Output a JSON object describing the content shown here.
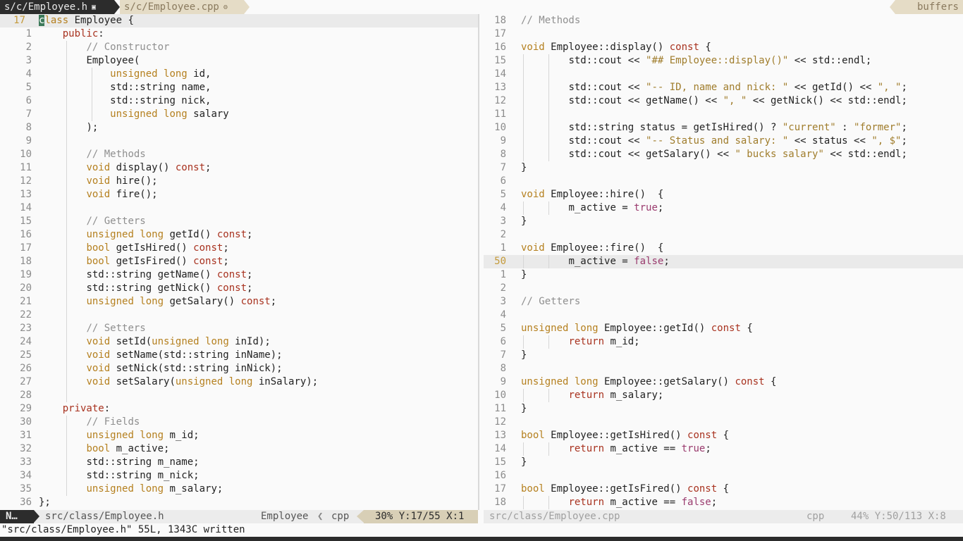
{
  "tabline": {
    "active_tab": "s/c/Employee.h",
    "active_tab_icon": "▣",
    "inactive_tab": "s/c/Employee.cpp",
    "inactive_tab_icon": "⚙",
    "buffers_label": "buffers"
  },
  "left_pane": {
    "lines": [
      {
        "ln": "17",
        "current": true,
        "indent": 0,
        "tokens": [
          [
            "cursor",
            "c"
          ],
          [
            "ty",
            "lass"
          ],
          [
            "",
            " Employee {"
          ]
        ]
      },
      {
        "ln": "1",
        "indent": 4,
        "tokens": [
          [
            "kw",
            "public"
          ],
          [
            "",
            ":"
          ]
        ]
      },
      {
        "ln": "2",
        "indent": 8,
        "tokens": [
          [
            "cm",
            "// Constructor"
          ]
        ]
      },
      {
        "ln": "3",
        "indent": 8,
        "tokens": [
          [
            "",
            "Employee("
          ]
        ]
      },
      {
        "ln": "4",
        "indent": 12,
        "tokens": [
          [
            "ty",
            "unsigned long"
          ],
          [
            "",
            " id,"
          ]
        ]
      },
      {
        "ln": "5",
        "indent": 12,
        "tokens": [
          [
            "",
            "std::string name,"
          ]
        ]
      },
      {
        "ln": "6",
        "indent": 12,
        "tokens": [
          [
            "",
            "std::string nick,"
          ]
        ]
      },
      {
        "ln": "7",
        "indent": 12,
        "tokens": [
          [
            "ty",
            "unsigned long"
          ],
          [
            "",
            " salary"
          ]
        ]
      },
      {
        "ln": "8",
        "indent": 8,
        "tokens": [
          [
            "",
            ");"
          ]
        ]
      },
      {
        "ln": "9",
        "indent": 8,
        "tokens": []
      },
      {
        "ln": "10",
        "indent": 8,
        "tokens": [
          [
            "cm",
            "// Methods"
          ]
        ]
      },
      {
        "ln": "11",
        "indent": 8,
        "tokens": [
          [
            "ty",
            "void"
          ],
          [
            "",
            " display() "
          ],
          [
            "kw",
            "const"
          ],
          [
            "",
            ";"
          ]
        ]
      },
      {
        "ln": "12",
        "indent": 8,
        "tokens": [
          [
            "ty",
            "void"
          ],
          [
            "",
            " hire();"
          ]
        ]
      },
      {
        "ln": "13",
        "indent": 8,
        "tokens": [
          [
            "ty",
            "void"
          ],
          [
            "",
            " fire();"
          ]
        ]
      },
      {
        "ln": "14",
        "indent": 8,
        "tokens": []
      },
      {
        "ln": "15",
        "indent": 8,
        "tokens": [
          [
            "cm",
            "// Getters"
          ]
        ]
      },
      {
        "ln": "16",
        "indent": 8,
        "tokens": [
          [
            "ty",
            "unsigned long"
          ],
          [
            "",
            " getId() "
          ],
          [
            "kw",
            "const"
          ],
          [
            "",
            ";"
          ]
        ]
      },
      {
        "ln": "17",
        "indent": 8,
        "tokens": [
          [
            "ty",
            "bool"
          ],
          [
            "",
            " getIsHired() "
          ],
          [
            "kw",
            "const"
          ],
          [
            "",
            ";"
          ]
        ]
      },
      {
        "ln": "18",
        "indent": 8,
        "tokens": [
          [
            "ty",
            "bool"
          ],
          [
            "",
            " getIsFired() "
          ],
          [
            "kw",
            "const"
          ],
          [
            "",
            ";"
          ]
        ]
      },
      {
        "ln": "19",
        "indent": 8,
        "tokens": [
          [
            "",
            "std::string getName() "
          ],
          [
            "kw",
            "const"
          ],
          [
            "",
            ";"
          ]
        ]
      },
      {
        "ln": "20",
        "indent": 8,
        "tokens": [
          [
            "",
            "std::string getNick() "
          ],
          [
            "kw",
            "const"
          ],
          [
            "",
            ";"
          ]
        ]
      },
      {
        "ln": "21",
        "indent": 8,
        "tokens": [
          [
            "ty",
            "unsigned long"
          ],
          [
            "",
            " getSalary() "
          ],
          [
            "kw",
            "const"
          ],
          [
            "",
            ";"
          ]
        ]
      },
      {
        "ln": "22",
        "indent": 8,
        "tokens": []
      },
      {
        "ln": "23",
        "indent": 8,
        "tokens": [
          [
            "cm",
            "// Setters"
          ]
        ]
      },
      {
        "ln": "24",
        "indent": 8,
        "tokens": [
          [
            "ty",
            "void"
          ],
          [
            "",
            " setId("
          ],
          [
            "ty",
            "unsigned long"
          ],
          [
            "",
            " inId);"
          ]
        ]
      },
      {
        "ln": "25",
        "indent": 8,
        "tokens": [
          [
            "ty",
            "void"
          ],
          [
            "",
            " setName(std::string inName);"
          ]
        ]
      },
      {
        "ln": "26",
        "indent": 8,
        "tokens": [
          [
            "ty",
            "void"
          ],
          [
            "",
            " setNick(std::string inNick);"
          ]
        ]
      },
      {
        "ln": "27",
        "indent": 8,
        "tokens": [
          [
            "ty",
            "void"
          ],
          [
            "",
            " setSalary("
          ],
          [
            "ty",
            "unsigned long"
          ],
          [
            "",
            " inSalary);"
          ]
        ]
      },
      {
        "ln": "28",
        "indent": 8,
        "tokens": []
      },
      {
        "ln": "29",
        "indent": 4,
        "tokens": [
          [
            "kw",
            "private"
          ],
          [
            "",
            ":"
          ]
        ]
      },
      {
        "ln": "30",
        "indent": 8,
        "tokens": [
          [
            "cm",
            "// Fields"
          ]
        ]
      },
      {
        "ln": "31",
        "indent": 8,
        "tokens": [
          [
            "ty",
            "unsigned long"
          ],
          [
            "",
            " m_id;"
          ]
        ]
      },
      {
        "ln": "32",
        "indent": 8,
        "tokens": [
          [
            "ty",
            "bool"
          ],
          [
            "",
            " m_active;"
          ]
        ]
      },
      {
        "ln": "33",
        "indent": 8,
        "tokens": [
          [
            "",
            "std::string m_name;"
          ]
        ]
      },
      {
        "ln": "34",
        "indent": 8,
        "tokens": [
          [
            "",
            "std::string m_nick;"
          ]
        ]
      },
      {
        "ln": "35",
        "indent": 8,
        "tokens": [
          [
            "ty",
            "unsigned long"
          ],
          [
            "",
            " m_salary;"
          ]
        ]
      },
      {
        "ln": "36",
        "indent": 0,
        "tokens": [
          [
            "",
            "};"
          ]
        ]
      }
    ]
  },
  "right_pane": {
    "lines": [
      {
        "ln": "18",
        "indent": 0,
        "tokens": [
          [
            "cm",
            "// Methods"
          ]
        ]
      },
      {
        "ln": "17",
        "indent": 0,
        "tokens": []
      },
      {
        "ln": "16",
        "indent": 0,
        "tokens": [
          [
            "ty",
            "void"
          ],
          [
            "",
            " Employee::display() "
          ],
          [
            "kw",
            "const"
          ],
          [
            "",
            " {"
          ]
        ]
      },
      {
        "ln": "15",
        "indent": 8,
        "tokens": [
          [
            "",
            "std::cout << "
          ],
          [
            "st",
            "\"## Employee::display()\""
          ],
          [
            "",
            " << std::endl;"
          ]
        ]
      },
      {
        "ln": "14",
        "indent": 8,
        "tokens": []
      },
      {
        "ln": "13",
        "indent": 8,
        "tokens": [
          [
            "",
            "std::cout << "
          ],
          [
            "st",
            "\"-- ID, name and nick: \""
          ],
          [
            "",
            " << getId() << "
          ],
          [
            "st",
            "\", \""
          ],
          [
            "",
            ";"
          ]
        ]
      },
      {
        "ln": "12",
        "indent": 8,
        "tokens": [
          [
            "",
            "std::cout << getName() << "
          ],
          [
            "st",
            "\", \""
          ],
          [
            "",
            " << getNick() << std::endl;"
          ]
        ]
      },
      {
        "ln": "11",
        "indent": 8,
        "tokens": []
      },
      {
        "ln": "10",
        "indent": 8,
        "tokens": [
          [
            "",
            "std::string status = getIsHired() ? "
          ],
          [
            "st",
            "\"current\""
          ],
          [
            "",
            " : "
          ],
          [
            "st",
            "\"former\""
          ],
          [
            "",
            ";"
          ]
        ]
      },
      {
        "ln": "9",
        "indent": 8,
        "tokens": [
          [
            "",
            "std::cout << "
          ],
          [
            "st",
            "\"-- Status and salary: \""
          ],
          [
            "",
            " << status << "
          ],
          [
            "st",
            "\", $\""
          ],
          [
            "",
            ";"
          ]
        ]
      },
      {
        "ln": "8",
        "indent": 8,
        "tokens": [
          [
            "",
            "std::cout << getSalary() << "
          ],
          [
            "st",
            "\" bucks salary\""
          ],
          [
            "",
            " << std::endl;"
          ]
        ]
      },
      {
        "ln": "7",
        "indent": 0,
        "tokens": [
          [
            "",
            "}"
          ]
        ]
      },
      {
        "ln": "6",
        "indent": 0,
        "tokens": []
      },
      {
        "ln": "5",
        "indent": 0,
        "tokens": [
          [
            "ty",
            "void"
          ],
          [
            "",
            " Employee::hire()  {"
          ]
        ]
      },
      {
        "ln": "4",
        "indent": 8,
        "tokens": [
          [
            "",
            "m_active = "
          ],
          [
            "bl",
            "true"
          ],
          [
            "",
            ";"
          ]
        ]
      },
      {
        "ln": "3",
        "indent": 0,
        "tokens": [
          [
            "",
            "}"
          ]
        ]
      },
      {
        "ln": "2",
        "indent": 0,
        "tokens": []
      },
      {
        "ln": "1",
        "indent": 0,
        "tokens": [
          [
            "ty",
            "void"
          ],
          [
            "",
            " Employee::fire()  {"
          ]
        ]
      },
      {
        "ln": "50",
        "current": true,
        "indent": 8,
        "tokens": [
          [
            "",
            "m_active = "
          ],
          [
            "bl",
            "false"
          ],
          [
            "",
            ";"
          ]
        ]
      },
      {
        "ln": "1",
        "indent": 0,
        "tokens": [
          [
            "",
            "}"
          ]
        ]
      },
      {
        "ln": "2",
        "indent": 0,
        "tokens": []
      },
      {
        "ln": "3",
        "indent": 0,
        "tokens": [
          [
            "cm",
            "// Getters"
          ]
        ]
      },
      {
        "ln": "4",
        "indent": 0,
        "tokens": []
      },
      {
        "ln": "5",
        "indent": 0,
        "tokens": [
          [
            "ty",
            "unsigned long"
          ],
          [
            "",
            " Employee::getId() "
          ],
          [
            "kw",
            "const"
          ],
          [
            "",
            " {"
          ]
        ]
      },
      {
        "ln": "6",
        "indent": 8,
        "tokens": [
          [
            "kw",
            "return"
          ],
          [
            "",
            " m_id;"
          ]
        ]
      },
      {
        "ln": "7",
        "indent": 0,
        "tokens": [
          [
            "",
            "}"
          ]
        ]
      },
      {
        "ln": "8",
        "indent": 0,
        "tokens": []
      },
      {
        "ln": "9",
        "indent": 0,
        "tokens": [
          [
            "ty",
            "unsigned long"
          ],
          [
            "",
            " Employee::getSalary() "
          ],
          [
            "kw",
            "const"
          ],
          [
            "",
            " {"
          ]
        ]
      },
      {
        "ln": "10",
        "indent": 8,
        "tokens": [
          [
            "kw",
            "return"
          ],
          [
            "",
            " m_salary;"
          ]
        ]
      },
      {
        "ln": "11",
        "indent": 0,
        "tokens": [
          [
            "",
            "}"
          ]
        ]
      },
      {
        "ln": "12",
        "indent": 0,
        "tokens": []
      },
      {
        "ln": "13",
        "indent": 0,
        "tokens": [
          [
            "ty",
            "bool"
          ],
          [
            "",
            " Employee::getIsHired() "
          ],
          [
            "kw",
            "const"
          ],
          [
            "",
            " {"
          ]
        ]
      },
      {
        "ln": "14",
        "indent": 8,
        "tokens": [
          [
            "kw",
            "return"
          ],
          [
            "",
            " m_active == "
          ],
          [
            "bl",
            "true"
          ],
          [
            "",
            ";"
          ]
        ]
      },
      {
        "ln": "15",
        "indent": 0,
        "tokens": [
          [
            "",
            "}"
          ]
        ]
      },
      {
        "ln": "16",
        "indent": 0,
        "tokens": []
      },
      {
        "ln": "17",
        "indent": 0,
        "tokens": [
          [
            "ty",
            "bool"
          ],
          [
            "",
            " Employee::getIsFired() "
          ],
          [
            "kw",
            "const"
          ],
          [
            "",
            " {"
          ]
        ]
      },
      {
        "ln": "18",
        "indent": 8,
        "tokens": [
          [
            "kw",
            "return"
          ],
          [
            "",
            " m_active == "
          ],
          [
            "bl",
            "false"
          ],
          [
            "",
            ";"
          ]
        ]
      }
    ]
  },
  "statusbar": {
    "mode": "N…",
    "left_file": "src/class/Employee.h",
    "left_function": "Employee",
    "left_separator": "❮",
    "left_filetype": "cpp",
    "left_position": "30% Y:17/55 X:1",
    "right_file": "src/class/Employee.cpp",
    "right_filetype": "cpp",
    "right_position": "44% Y:50/113 X:8"
  },
  "cmdline": {
    "message": "\"src/class/Employee.h\" 55L, 1343C written"
  },
  "colors": {
    "keyword": "#a8321f",
    "type": "#b5801f",
    "comment": "#8f8f8f",
    "string": "#a07d2c",
    "boolean": "#9a3b6e",
    "cursor": "#3d7a5a",
    "statusbar_dark": "#2c2c2c",
    "tab_inactive": "#e5dcc6"
  }
}
